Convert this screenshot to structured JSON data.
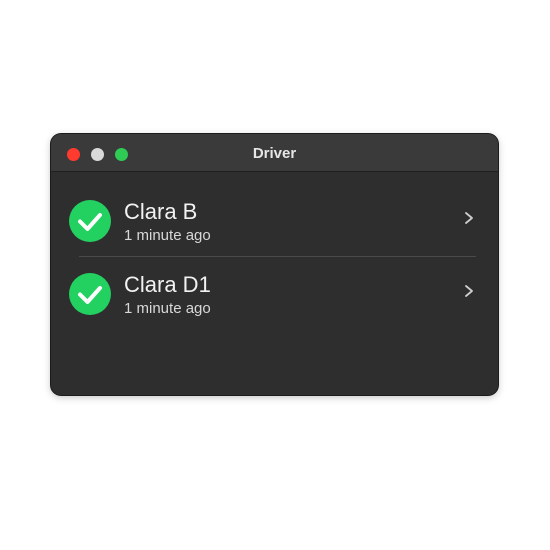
{
  "window": {
    "title": "Driver"
  },
  "items": [
    {
      "name": "Clara B",
      "time": "1 minute ago",
      "status_icon": "check-circle-icon",
      "status_color": "#22d160"
    },
    {
      "name": "Clara D1",
      "time": "1 minute ago",
      "status_icon": "check-circle-icon",
      "status_color": "#22d160"
    }
  ],
  "colors": {
    "close": "#ff3b30",
    "minimize": "#d9d9d9",
    "maximize": "#2ecc55",
    "window_bg": "#2e2e2f"
  }
}
